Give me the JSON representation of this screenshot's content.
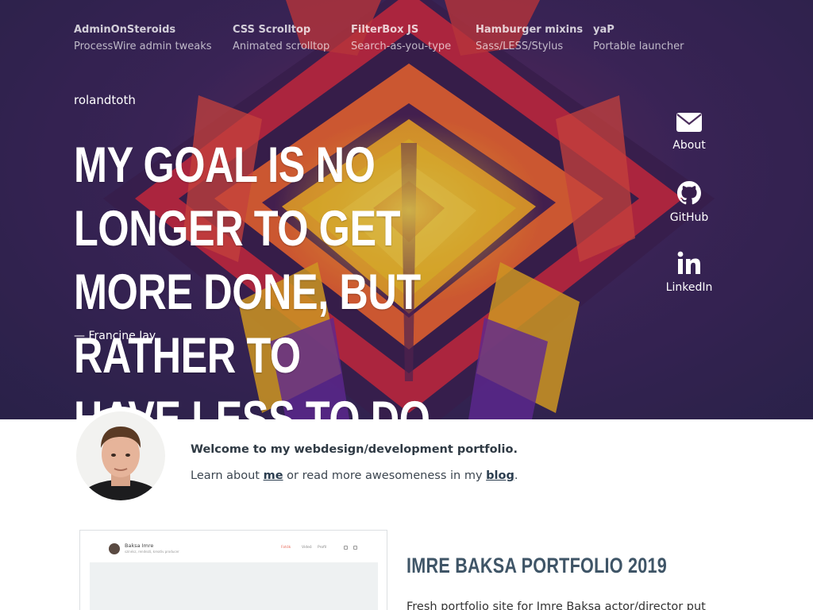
{
  "projects": [
    {
      "name": "AdminOnSteroids",
      "desc": "ProcessWire admin tweaks"
    },
    {
      "name": "CSS Scrolltop",
      "desc": "Animated scrolltop"
    },
    {
      "name": "FilterBox JS",
      "desc": "Search-as-you-type"
    },
    {
      "name": "Hamburger mixins",
      "desc": "Sass/LESS/Stylus"
    },
    {
      "name": "yaP",
      "desc": "Portable launcher"
    }
  ],
  "brand": "rolandtoth",
  "quote": {
    "line1": "MY GOAL IS NO LONGER TO GET",
    "line2": "MORE DONE, BUT RATHER TO",
    "line3": "HAVE LESS TO DO.",
    "author": "— Francine Jay"
  },
  "social": {
    "about": {
      "label": "About",
      "icon": "envelope-icon"
    },
    "github": {
      "label": "GitHub",
      "icon": "github-icon"
    },
    "linkedin": {
      "label": "LinkedIn",
      "icon": "linkedin-icon"
    }
  },
  "intro": {
    "welcome": "Welcome to my webdesign/development portfolio.",
    "learn_prefix": "Learn about ",
    "me_link": "me",
    "learn_middle": " or read more awesomeness in my ",
    "blog_link": "blog",
    "learn_suffix": "."
  },
  "portfolio": {
    "title": "IMRE BAKSA PORTFOLIO 2019",
    "text": "Fresh portfolio site for Imre Baksa actor/director put",
    "thumbnail": {
      "name": "Baksa Imre",
      "subtitle": "színész, rendező, kreatív producer",
      "nav": [
        "Fotók",
        "Videó",
        "Profil"
      ]
    }
  },
  "colors": {
    "hero_bg": "#2a2349",
    "accent_yellow": "#f5c518",
    "accent_orange": "#f0642c",
    "link": "#2c3e50",
    "title": "#3f5567"
  }
}
